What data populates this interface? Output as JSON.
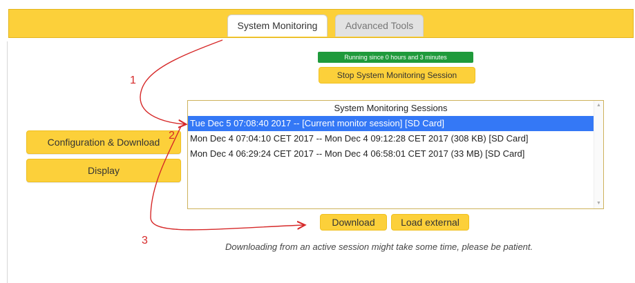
{
  "tabs": [
    {
      "label": "System Monitoring",
      "active": true
    },
    {
      "label": "Advanced Tools",
      "active": false
    }
  ],
  "status": {
    "running": "Running since 0 hours and 3 minutes"
  },
  "buttons": {
    "stop": "Stop System Monitoring Session",
    "config": "Configuration & Download",
    "display": "Display",
    "download": "Download",
    "load_external": "Load external"
  },
  "sessions": {
    "title": "System Monitoring Sessions",
    "rows": [
      "Tue Dec 5 07:08:40 2017 -- [Current monitor session] [SD Card]",
      "Mon Dec 4 07:04:10 CET 2017 -- Mon Dec 4 09:12:28 CET 2017 (308 KB) [SD Card]",
      "Mon Dec 4 06:29:24 CET 2017 -- Mon Dec 4 06:58:01 CET 2017 (33 MB) [SD Card]"
    ],
    "selected_index": 0
  },
  "note": "Downloading from an active session might take some time, please be patient.",
  "annotations": [
    "1",
    "2",
    "3"
  ],
  "colors": {
    "accent": "#fcd03a",
    "status_green": "#1f9a3b",
    "selection_blue": "#3478f6",
    "annotation_red": "#d62828"
  }
}
